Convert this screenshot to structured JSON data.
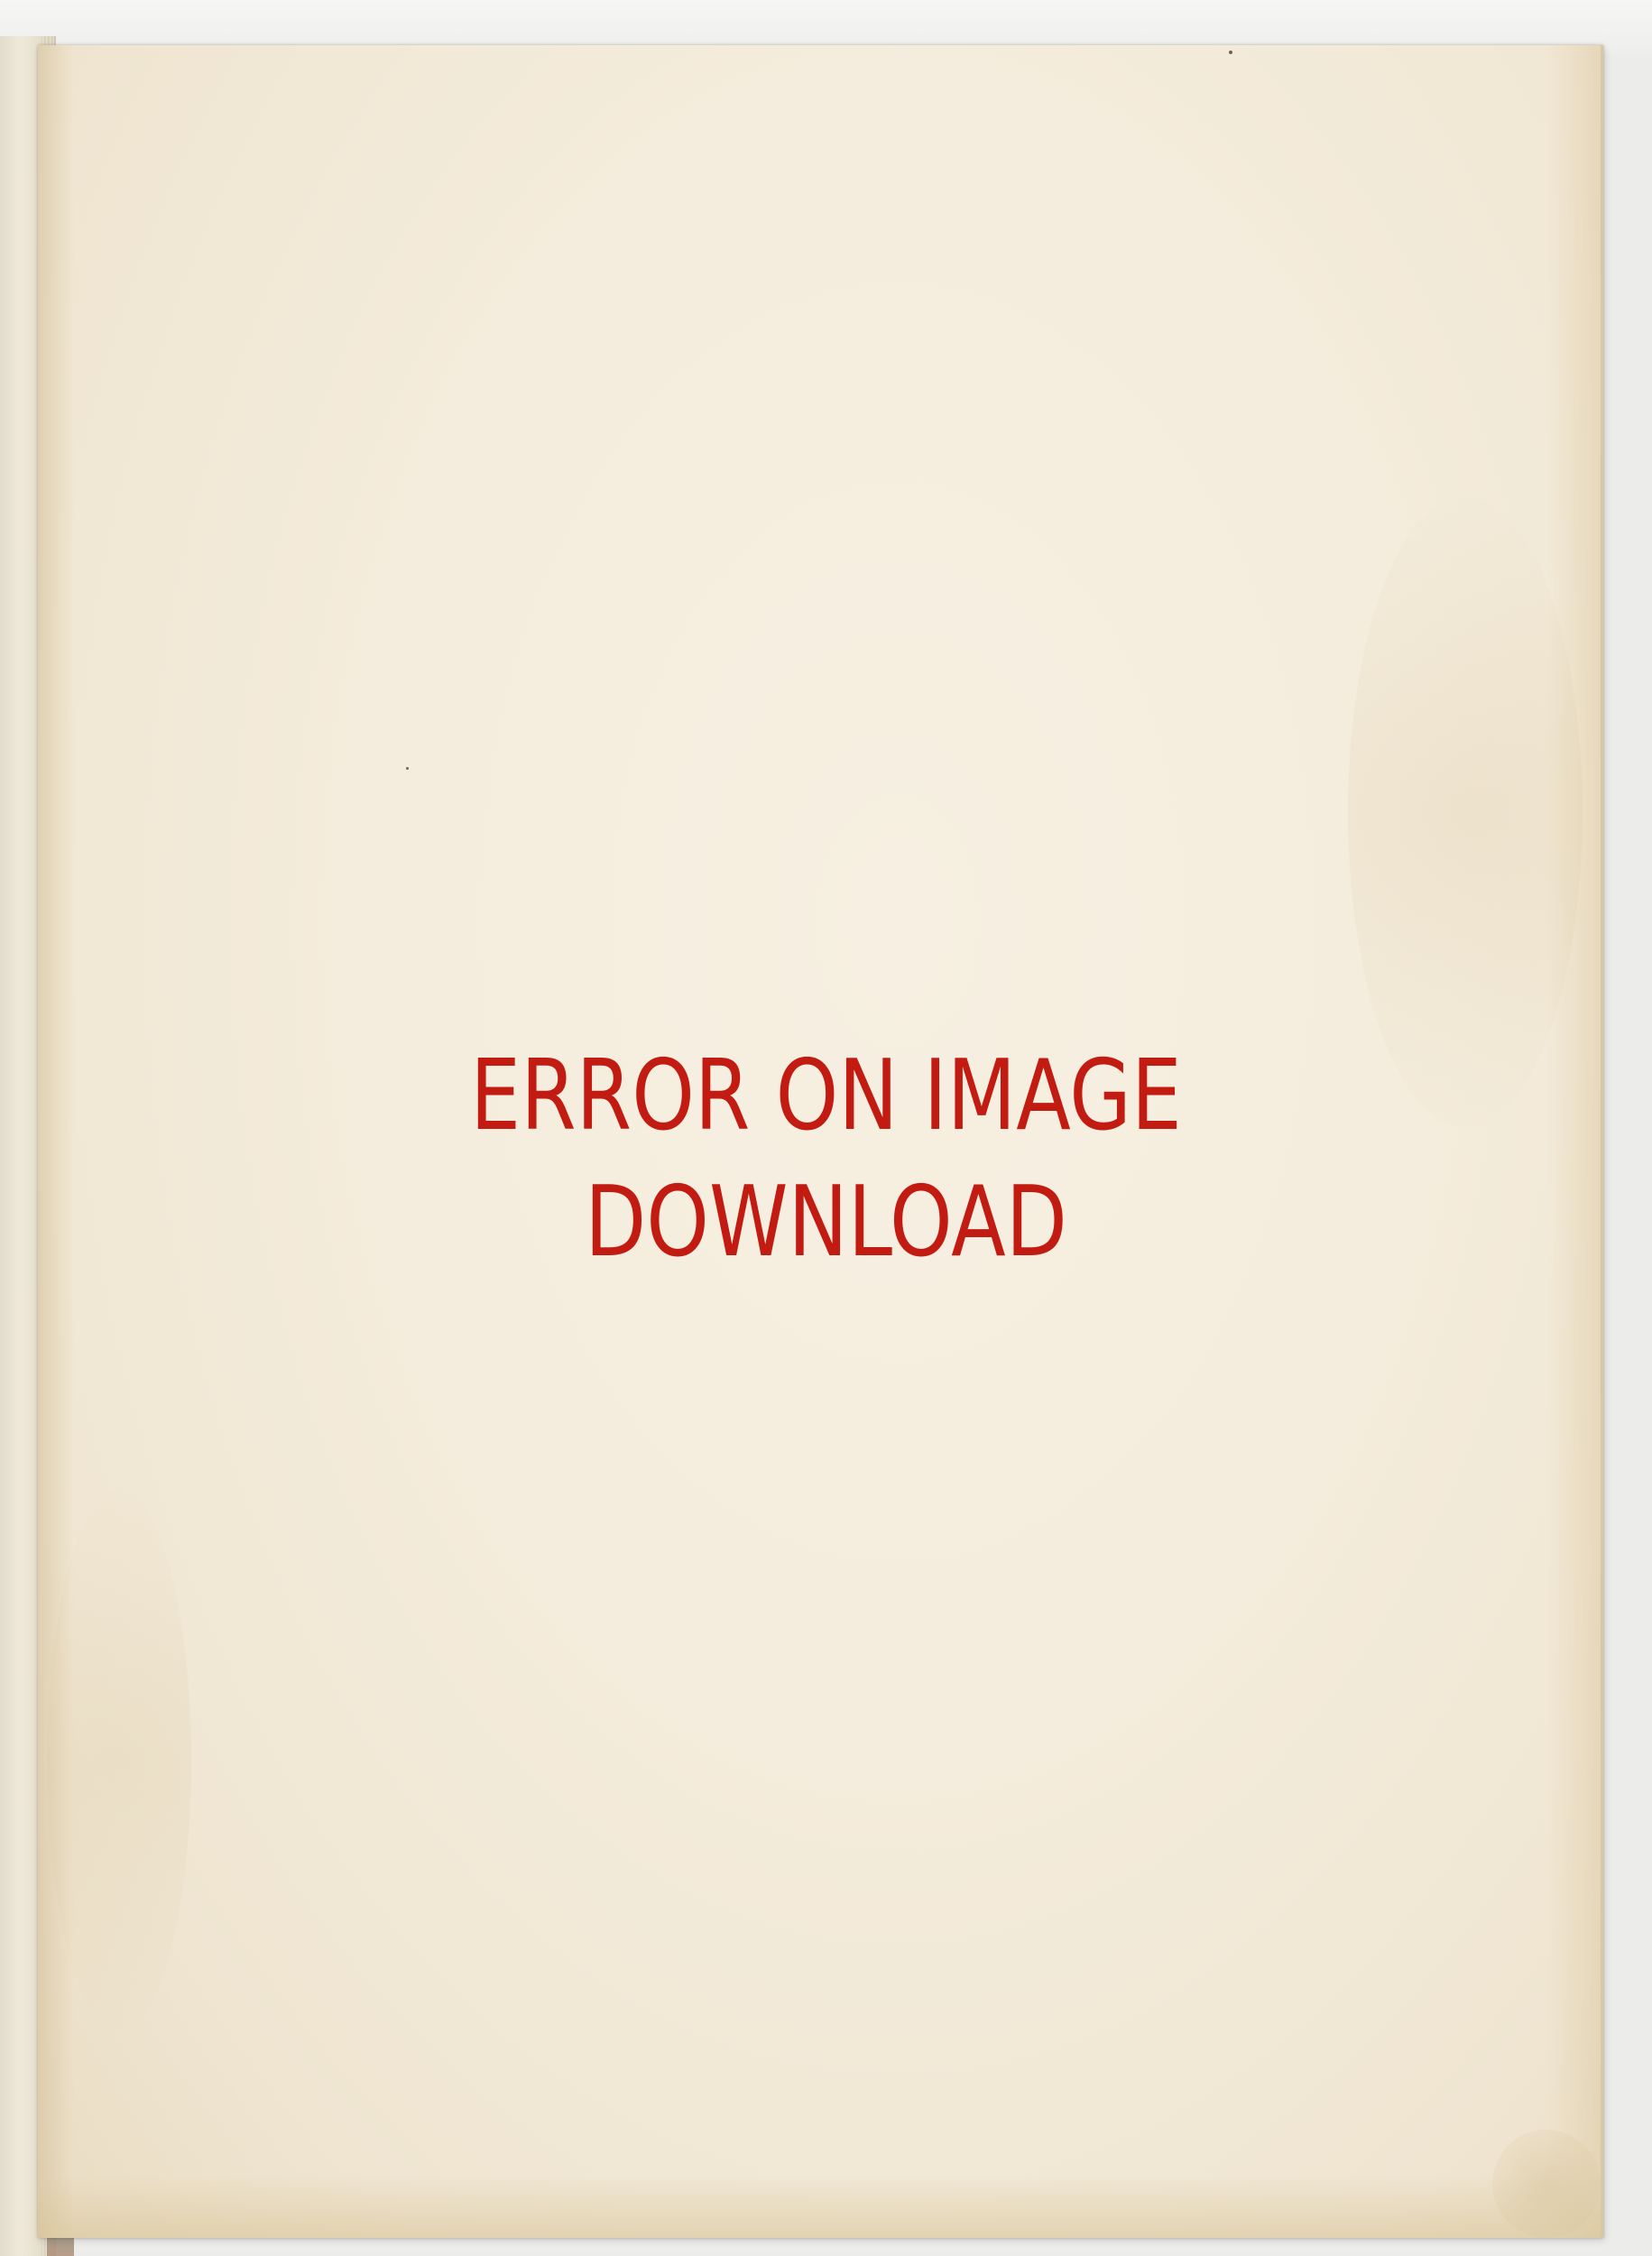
{
  "overlay": {
    "line1": "ERROR ON IMAGE",
    "line2": "DOWNLOAD",
    "color": "#c21b12"
  },
  "scene": {
    "paper_color": "#f4ecdc",
    "backdrop_color": "#ececea"
  }
}
